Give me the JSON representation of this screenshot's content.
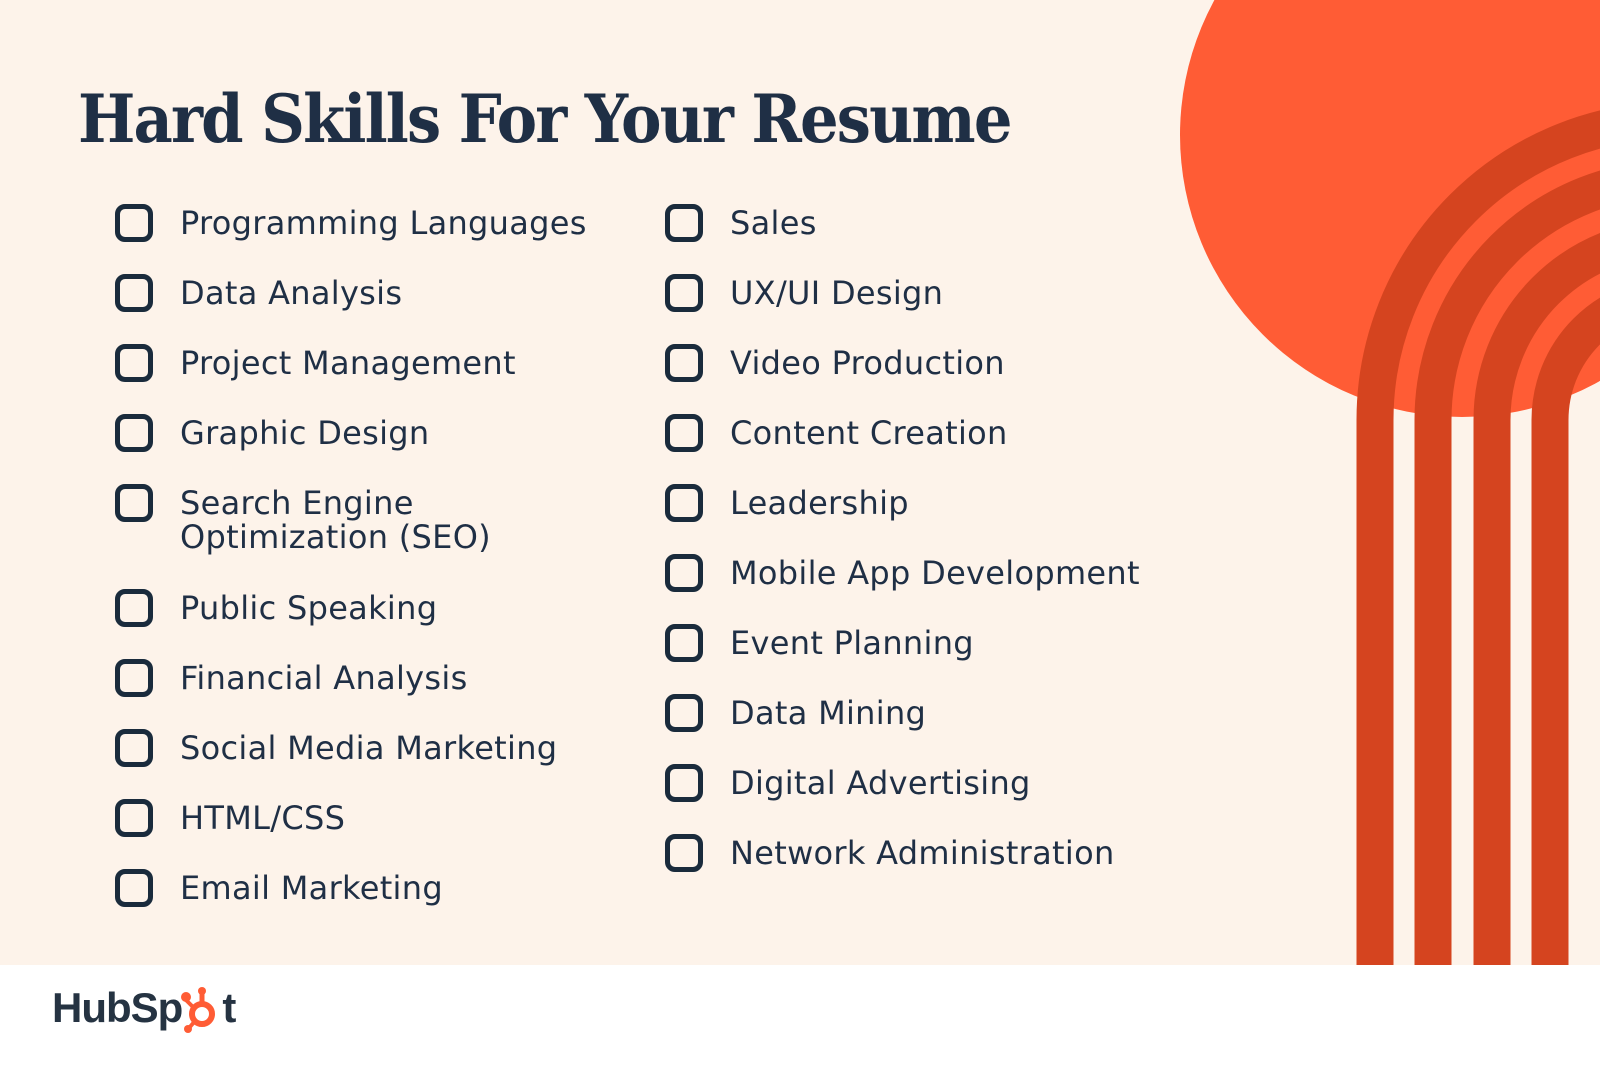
{
  "title": "Hard Skills For Your Resume",
  "colors": {
    "background": "#FDF3EA",
    "text": "#1F2F45",
    "circle": "#FF5C35",
    "arches": "#D5441F",
    "logo_accent": "#FF5C35"
  },
  "skills": {
    "left": [
      {
        "label": "Programming Languages",
        "checked": false
      },
      {
        "label": "Data Analysis",
        "checked": false
      },
      {
        "label": "Project Management",
        "checked": false
      },
      {
        "label": "Graphic Design",
        "checked": false
      },
      {
        "label": "Search Engine Optimization (SEO)",
        "checked": false
      },
      {
        "label": "Public Speaking",
        "checked": false
      },
      {
        "label": "Financial Analysis",
        "checked": false
      },
      {
        "label": "Social Media Marketing",
        "checked": false
      },
      {
        "label": "HTML/CSS",
        "checked": false
      },
      {
        "label": "Email Marketing",
        "checked": false
      }
    ],
    "right": [
      {
        "label": "Sales",
        "checked": false
      },
      {
        "label": "UX/UI Design",
        "checked": false
      },
      {
        "label": "Video Production",
        "checked": false
      },
      {
        "label": "Content Creation",
        "checked": false
      },
      {
        "label": "Leadership",
        "checked": false
      },
      {
        "label": "Mobile App Development",
        "checked": false
      },
      {
        "label": "Event Planning",
        "checked": false
      },
      {
        "label": "Data Mining",
        "checked": false
      },
      {
        "label": "Digital Advertising",
        "checked": false
      },
      {
        "label": "Network Administration",
        "checked": false
      }
    ]
  },
  "footer": {
    "logo_text_a": "HubSp",
    "logo_text_b": "t",
    "logo_icon": "sprocket-icon"
  }
}
